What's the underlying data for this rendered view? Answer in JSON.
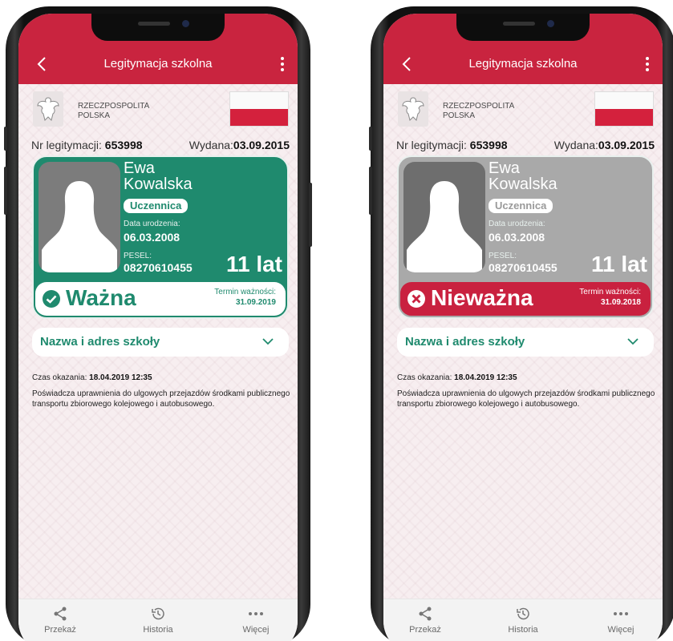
{
  "screens": [
    {
      "state": "valid",
      "header": {
        "title": "Legitymacja szkolna"
      },
      "issuer": {
        "line1": "RZECZPOSPOLITA",
        "line2": "POLSKA"
      },
      "id_row": {
        "nr_label": "Nr legitymacji:",
        "nr_value": "653998",
        "issued_label": "Wydana:",
        "issued_value": "03.09.2015"
      },
      "card": {
        "first_name": "Ewa",
        "last_name": "Kowalska",
        "role": "Uczennica",
        "dob_label": "Data urodzenia:",
        "dob": "06.03.2008",
        "pesel_label": "PESEL:",
        "pesel": "08270610455",
        "age": "11 lat",
        "status": "Ważna",
        "term_label": "Termin ważności:",
        "term": "31.09.2019"
      },
      "school": {
        "label": "Nazwa i adres szkoły"
      },
      "info": {
        "czas_label": "Czas okazania:",
        "czas": "18.04.2019 12:35",
        "desc": "Poświadcza uprawnienia do ulgowych przejazdów środkami publicznego transportu zbiorowego kolejowego i autobusowego."
      },
      "nav": {
        "share": "Przekaż",
        "history": "Historia",
        "more": "Więcej"
      }
    },
    {
      "state": "invalid",
      "header": {
        "title": "Legitymacja szkolna"
      },
      "issuer": {
        "line1": "RZECZPOSPOLITA",
        "line2": "POLSKA"
      },
      "id_row": {
        "nr_label": "Nr legitymacji:",
        "nr_value": "653998",
        "issued_label": "Wydana:",
        "issued_value": "03.09.2015"
      },
      "card": {
        "first_name": "Ewa",
        "last_name": "Kowalska",
        "role": "Uczennica",
        "dob_label": "Data urodzenia:",
        "dob": "06.03.2008",
        "pesel_label": "PESEL:",
        "pesel": "08270610455",
        "age": "11 lat",
        "status": "Nieważna",
        "term_label": "Termin ważności:",
        "term": "31.09.2018"
      },
      "school": {
        "label": "Nazwa i adres szkoły"
      },
      "info": {
        "czas_label": "Czas okazania:",
        "czas": "18.04.2019 12:35",
        "desc": "Poświadcza uprawnienia do ulgowych przejazdów środkami publicznego transportu zbiorowego kolejowego i autobusowego."
      },
      "nav": {
        "share": "Przekaż",
        "history": "Historia",
        "more": "Więcej"
      }
    }
  ],
  "colors": {
    "brand_red": "#c9243f",
    "valid_green": "#1f8a6e",
    "invalid_gray": "#a9a9a9"
  }
}
